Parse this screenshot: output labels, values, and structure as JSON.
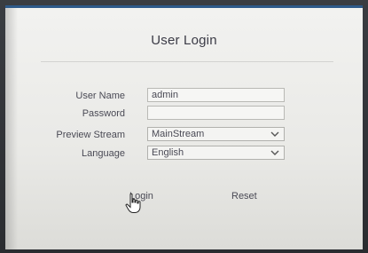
{
  "dialog": {
    "title": "User Login"
  },
  "form": {
    "username_label": "User Name",
    "username_value": "admin",
    "password_label": "Password",
    "password_value": "",
    "stream_label": "Preview Stream",
    "stream_value": "MainStream",
    "language_label": "Language",
    "language_value": "English"
  },
  "actions": {
    "login_label": "Login",
    "reset_label": "Reset"
  },
  "icons": {
    "dropdown": "chevron-down-icon",
    "pointer": "hand-pointer-icon"
  },
  "colors": {
    "accent_bar": "#2e5a8a",
    "text": "#4a4a55"
  }
}
